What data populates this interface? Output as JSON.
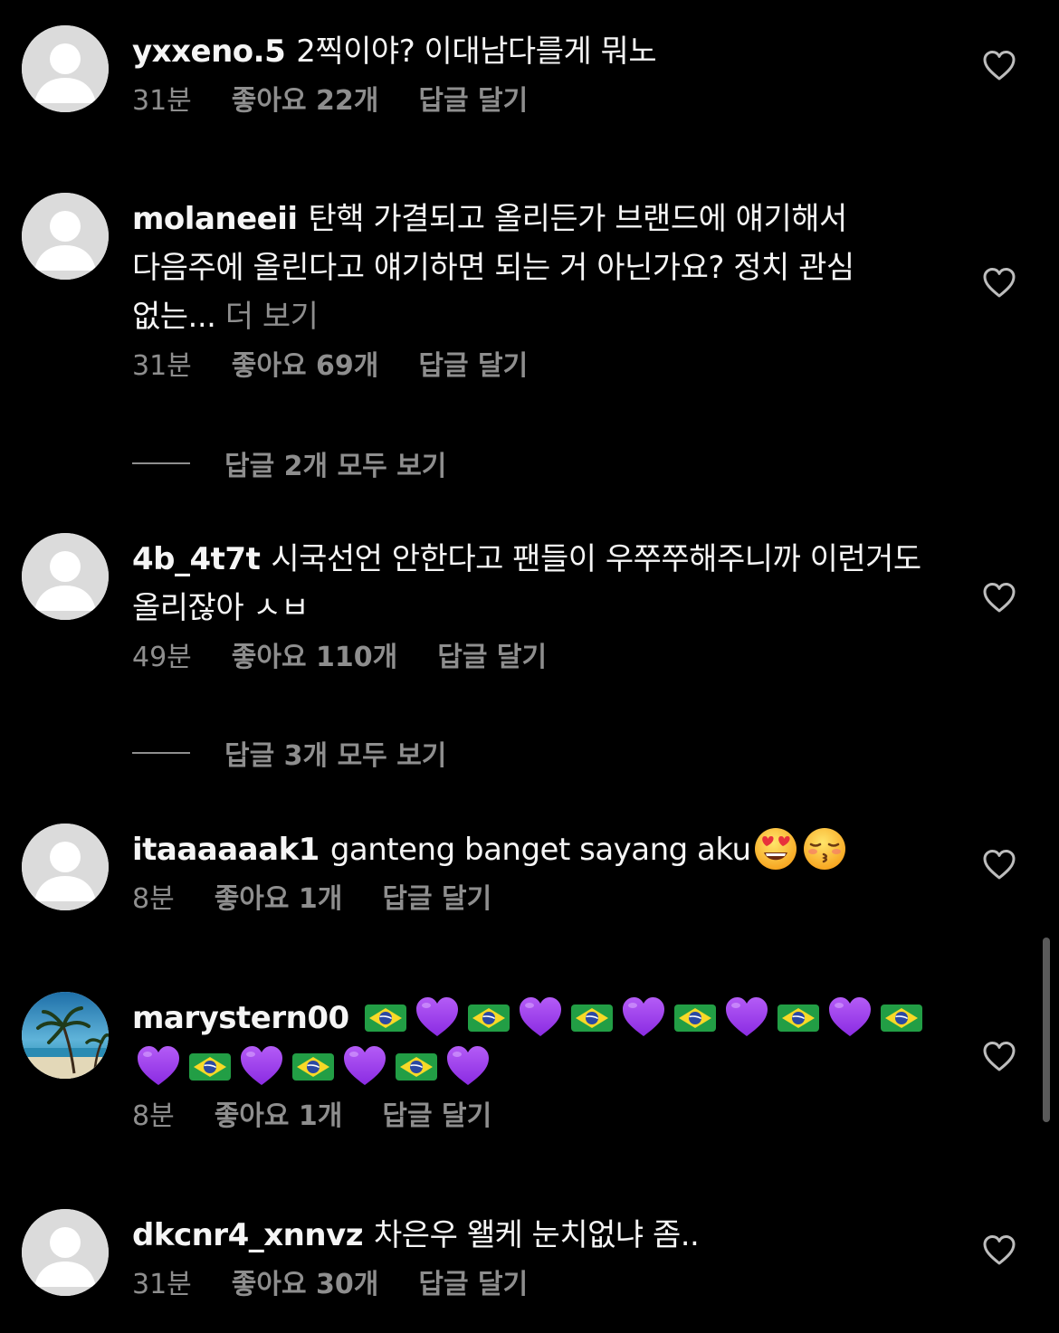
{
  "colors": {
    "background": "#000000",
    "text_primary": "#f5f5f5",
    "text_secondary": "#8e8e8e",
    "avatar_placeholder": "#dbdbdb",
    "heart_purple": "#9b3ee8"
  },
  "comments": [
    {
      "username": "yxxeno.5",
      "text": "2찍이야? 이대남다를게 뭐노",
      "time": "31분",
      "likes": "좋아요 22개",
      "reply": "답글 달기",
      "avatar": "default-avatar-icon"
    },
    {
      "username": "molaneeii",
      "text": "탄핵 가결되고 올리든가 브랜드에 얘기해서 다음주에 올린다고 얘기하면 되는 거 아닌가요? 정치 관심 없는...",
      "more": "더 보기",
      "time": "31분",
      "likes": "좋아요 69개",
      "reply": "답글 달기",
      "view_replies": "답글 2개 모두 보기",
      "avatar": "default-avatar-icon"
    },
    {
      "username": "4b_4t7t",
      "text": "시국선언 안한다고 팬들이 우쭈쭈해주니까 이런거도 올리잖아 ㅅㅂ",
      "time": "49분",
      "likes": "좋아요 110개",
      "reply": "답글 달기",
      "view_replies": "답글 3개 모두 보기",
      "avatar": "default-avatar-icon"
    },
    {
      "username": "itaaaaaak1",
      "text": "ganteng banget sayang aku",
      "emojis": [
        "heart-eyes-emoji",
        "kissing-emoji"
      ],
      "time": "8분",
      "likes": "좋아요 1개",
      "reply": "답글 달기",
      "avatar": "default-avatar-icon"
    },
    {
      "username": "marystern00",
      "emoji_sequence": "brazil-flag, purple-heart (x9 pairs)",
      "time": "8분",
      "likes": "좋아요 1개",
      "reply": "답글 달기",
      "avatar": "beach-palm-photo"
    },
    {
      "username": "dkcnr4_xnnvz",
      "text": "차은우 왤케 눈치없냐 좀..",
      "time": "31분",
      "likes": "좋아요 30개",
      "reply": "답글 달기",
      "avatar": "default-avatar-icon"
    }
  ]
}
